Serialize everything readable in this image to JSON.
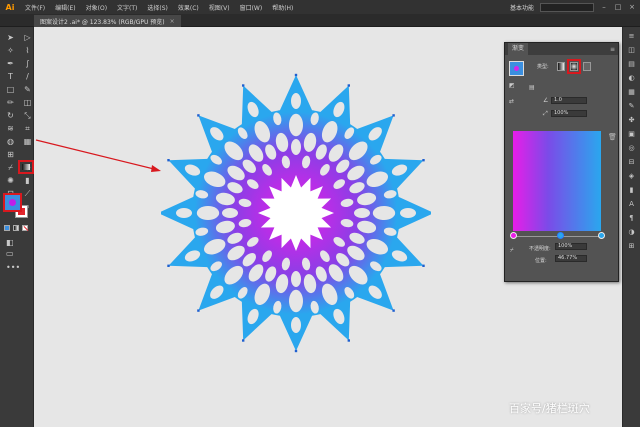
{
  "app": {
    "logo": "Ai"
  },
  "menubar": {
    "items": [
      "文件(F)",
      "编辑(E)",
      "对象(O)",
      "文字(T)",
      "选择(S)",
      "效果(C)",
      "视图(V)",
      "窗口(W)",
      "帮助(H)"
    ],
    "workspace": "基本功能"
  },
  "document": {
    "tab_title": "图案设计2 .ai* @ 123.83% (RGB/GPU 预览)",
    "close": "×"
  },
  "gradient_panel": {
    "tab": "渐变",
    "type_label": "类型:",
    "stroke_value": "1.0",
    "angle_value": "100%",
    "opacity_label": "不透明度:",
    "opacity_value": "100%",
    "location_label": "位置:",
    "location_value": "46.77%"
  },
  "watermark": "百家号/猪栏斑穴",
  "colors": {
    "gradient_start": "#e81de8",
    "gradient_end": "#2aa7ee",
    "highlight": "#d8181e"
  }
}
